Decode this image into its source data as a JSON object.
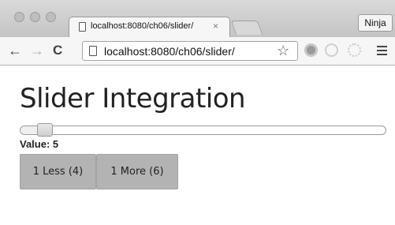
{
  "browser": {
    "tab_title": "localhost:8080/ch06/slider/",
    "tab_close": "×",
    "profile_label": "Ninja",
    "url": "localhost:8080/ch06/slider/",
    "icons": {
      "back": "←",
      "forward": "→",
      "reload": "C",
      "star": "☆"
    }
  },
  "page": {
    "heading": "Slider Integration",
    "value_label": "Value: 5",
    "slider": {
      "min": 0,
      "max": 100,
      "value": 5
    },
    "buttons": {
      "less": "1 Less (4)",
      "more": "1 More (6)"
    }
  }
}
